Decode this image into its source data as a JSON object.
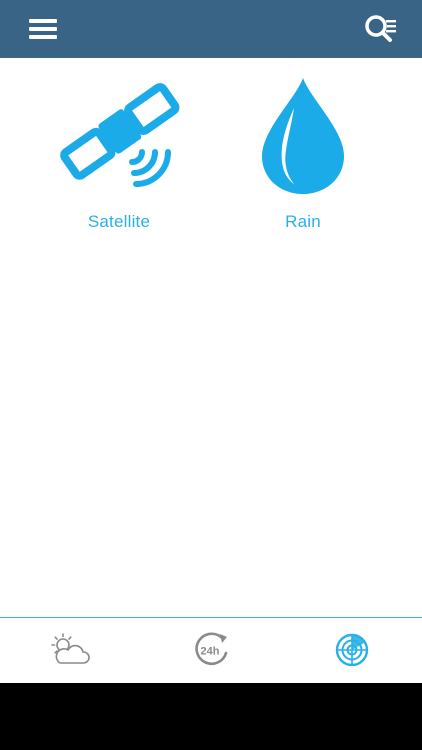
{
  "header": {
    "menu_icon": "hamburger-menu-icon",
    "search_icon": "search-list-icon",
    "background_color": "#3a6485"
  },
  "tiles": [
    {
      "label": "Satellite",
      "icon": "satellite-icon"
    },
    {
      "label": "Rain",
      "icon": "raindrop-icon"
    }
  ],
  "tabbar": {
    "tabs": [
      {
        "icon": "sun-cloud-icon",
        "active": false
      },
      {
        "icon": "24h-icon",
        "text": "24h",
        "active": false
      },
      {
        "icon": "radar-icon",
        "active": true
      }
    ],
    "accent_color": "#2ab0e8",
    "inactive_color": "#8a8a8a"
  }
}
